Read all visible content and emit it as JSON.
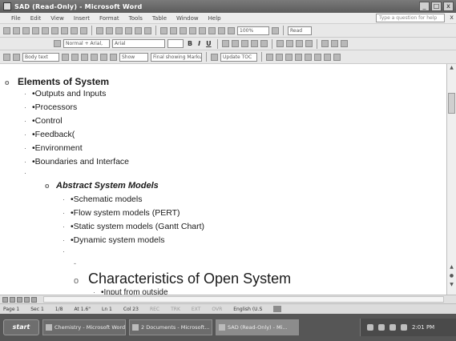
{
  "window": {
    "title": "SAD (Read-Only) - Microsoft Word",
    "controls": [
      "_",
      "□",
      "x"
    ]
  },
  "menu": {
    "items": [
      "File",
      "Edit",
      "View",
      "Insert",
      "Format",
      "Tools",
      "Table",
      "Window",
      "Help"
    ],
    "help_placeholder": "Type a question for help",
    "close": "x"
  },
  "toolbar": {
    "zoom": "100%",
    "read_label": "Read",
    "style": "Normal + Arial,",
    "font": "Arial",
    "bold": "B",
    "italic": "I",
    "underline": "U",
    "style_box2": "Body text",
    "show_label": "Show",
    "final_label": "Final showing Markup",
    "update_label": "Update TOC"
  },
  "document": {
    "lines": [
      {
        "marker": "o",
        "text": "Elements of System"
      },
      {
        "marker": "·",
        "text": "•Outputs and Inputs"
      },
      {
        "marker": "·",
        "text": "•Processors"
      },
      {
        "marker": "·",
        "text": "•Control"
      },
      {
        "marker": "·",
        "text": "•Feedback("
      },
      {
        "marker": "·",
        "text": "•Environment"
      },
      {
        "marker": "·",
        "text": "•Boundaries and Interface"
      },
      {
        "marker": "·",
        "text": ""
      },
      {
        "marker": "o",
        "text": "Abstract System Models"
      },
      {
        "marker": "·",
        "text": "•Schematic models"
      },
      {
        "marker": "·",
        "text": "•Flow system models (PERT)"
      },
      {
        "marker": "·",
        "text": "•Static system models (Gantt Chart)"
      },
      {
        "marker": "·",
        "text": "•Dynamic system models"
      },
      {
        "marker": "·",
        "text": ""
      },
      {
        "marker": "-",
        "text": ""
      },
      {
        "marker": "o",
        "text": "Characteristics of Open System"
      },
      {
        "marker": "·",
        "text": "•Input from outside"
      }
    ]
  },
  "status": {
    "page": "Page 1",
    "sec": "Sec 1",
    "fraction": "1/8",
    "at": "At 1.6\"",
    "ln": "Ln 1",
    "col": "Col 23",
    "rec": "REC",
    "trk": "TRK",
    "ext": "EXT",
    "ovr": "OVR",
    "language": "English (U.S"
  },
  "taskbar": {
    "start": "start",
    "tasks": [
      "Chemistry - Microsoft Word",
      "2 Documents - Microsoft...",
      "SAD (Read-Only) - Mi..."
    ],
    "clock": "2:01 PM"
  }
}
